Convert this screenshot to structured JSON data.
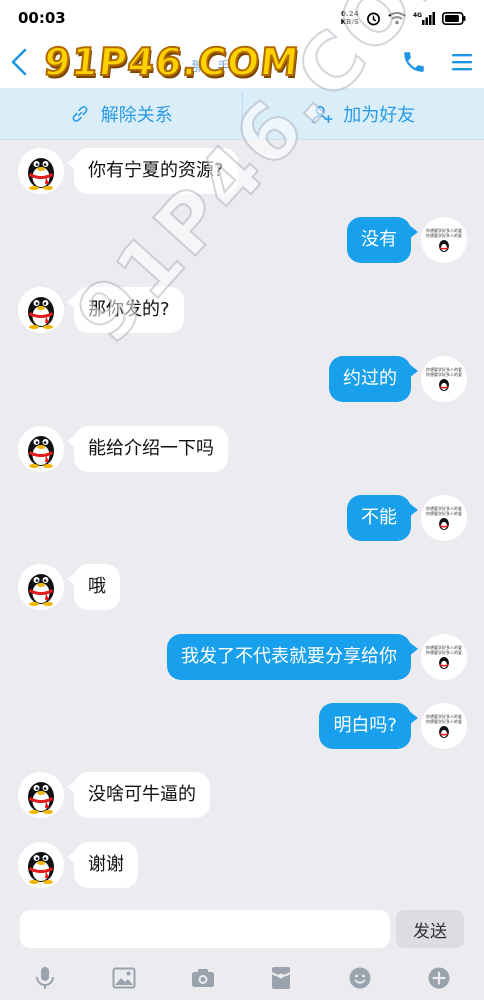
{
  "status_bar": {
    "time": "00:03",
    "net_speed_value": "0.24",
    "net_speed_unit": "KB/S",
    "network_type": "4G",
    "battery_level": 0.85
  },
  "header": {
    "watermark_logo": "91P46.COM",
    "contact_name": "…那…手"
  },
  "actions": {
    "unlink_label": "解除关系",
    "add_friend_label": "加为好友"
  },
  "watermark": "91P46.COM",
  "avatar_tiny_text": [
    "你想要学好多人的爱你",
    "你想要学好多人的爱你"
  ],
  "messages": [
    {
      "side": "left",
      "text": "你有宁夏的资源?"
    },
    {
      "side": "right",
      "text": "没有"
    },
    {
      "side": "left",
      "text": "那你发的?"
    },
    {
      "side": "right",
      "text": "约过的"
    },
    {
      "side": "left",
      "text": "能给介绍一下吗"
    },
    {
      "side": "right",
      "text": "不能"
    },
    {
      "side": "left",
      "text": "哦"
    },
    {
      "side": "right",
      "text": "我发了不代表就要分享给你"
    },
    {
      "side": "right",
      "text": "明白吗?"
    },
    {
      "side": "left",
      "text": "没啥可牛逼的"
    },
    {
      "side": "left",
      "text": "谢谢"
    }
  ],
  "input": {
    "placeholder": "",
    "send_label": "发送"
  },
  "colors": {
    "accent": "#19a0ec",
    "action_bar_bg": "#d9eef9",
    "chat_bg": "#ececf0"
  },
  "toolbar_icons": [
    "microphone-icon",
    "image-icon",
    "camera-icon",
    "red-packet-icon",
    "emoji-icon",
    "plus-icon"
  ]
}
